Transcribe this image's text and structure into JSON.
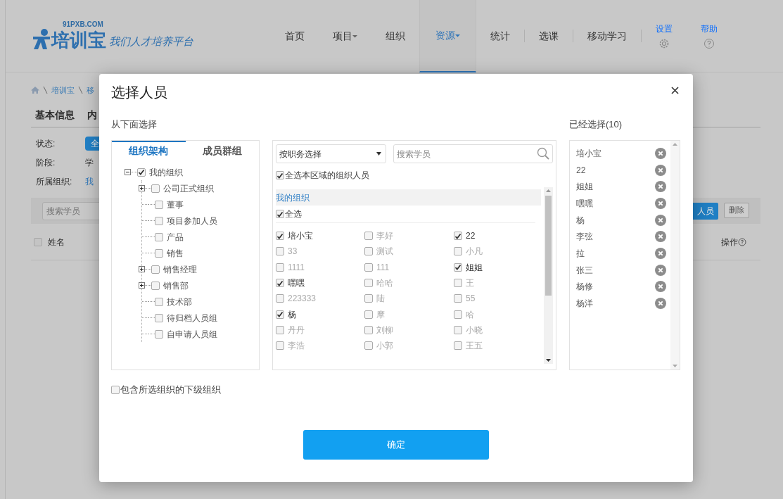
{
  "header": {
    "logo": {
      "domain": "91PXB.COM",
      "name": "培训宝",
      "slogan": "我们人才培养平台"
    },
    "nav": [
      {
        "label": "首页",
        "dropdown": false,
        "selected": false
      },
      {
        "label": "项目",
        "dropdown": true,
        "selected": false
      },
      {
        "label": "组织",
        "dropdown": false,
        "selected": false
      },
      {
        "label": "资源",
        "dropdown": true,
        "selected": true
      },
      {
        "label": "统计",
        "dropdown": false,
        "selected": false
      },
      {
        "label": "选课",
        "dropdown": false,
        "selected": false
      },
      {
        "label": "移动学习",
        "dropdown": false,
        "selected": false
      }
    ],
    "tools": [
      {
        "label": "设置",
        "kind": "settings"
      },
      {
        "label": "帮助",
        "kind": "help"
      }
    ]
  },
  "page": {
    "breadcrumb": [
      "培训宝",
      "移"
    ],
    "tabs": [
      "基本信息",
      "内"
    ],
    "filters": [
      {
        "label": "状态:",
        "value": "全",
        "kind": "pill"
      },
      {
        "label": "阶段:",
        "value": "学",
        "kind": "plain"
      },
      {
        "label": "所属组织:",
        "value": "我",
        "kind": "link"
      }
    ],
    "search": {
      "placeholder": "搜索学员"
    },
    "buttons": [
      {
        "label": "人员",
        "kind": "primary"
      },
      {
        "label": "删除",
        "kind": "outline"
      }
    ],
    "columns": [
      {
        "label": "姓名",
        "kind": "checkbox",
        "checked": false
      },
      {
        "label": "操作",
        "kind": "help"
      }
    ]
  },
  "dialog": {
    "title": "选择人员",
    "source_label": "从下面选择",
    "tabs": [
      {
        "label": "组织架构",
        "selected": true
      },
      {
        "label": "成员群组",
        "selected": false
      }
    ],
    "tree": [
      {
        "label": "我的组织",
        "checked": true,
        "kind": "branch",
        "expanded": true,
        "children": [
          {
            "label": "公司正式组织",
            "checked": false,
            "kind": "branch",
            "expanded": false
          },
          {
            "label": "董事",
            "checked": false,
            "kind": "leaf"
          },
          {
            "label": "项目参加人员",
            "checked": false,
            "kind": "leaf"
          },
          {
            "label": "产品",
            "checked": false,
            "kind": "leaf"
          },
          {
            "label": "销售",
            "checked": false,
            "kind": "leaf"
          },
          {
            "label": "销售经理",
            "checked": false,
            "kind": "branch",
            "expanded": false
          },
          {
            "label": "销售部",
            "checked": false,
            "kind": "branch",
            "expanded": false
          },
          {
            "label": "技术部",
            "checked": false,
            "kind": "leaf"
          },
          {
            "label": "待归档人员组",
            "checked": false,
            "kind": "leaf"
          },
          {
            "label": "自申请人员组",
            "checked": false,
            "kind": "leaf"
          }
        ]
      }
    ],
    "filter_select": {
      "value": "按职务选择"
    },
    "search": {
      "placeholder": "搜索学员"
    },
    "select_area": {
      "label": "全选本区域的组织人员",
      "checked": true
    },
    "group": {
      "title": "我的组织",
      "select_all": {
        "label": "全选",
        "checked": true
      },
      "people": [
        {
          "name": "培小宝",
          "checked": true
        },
        {
          "name": "李好",
          "checked": false
        },
        {
          "name": "22",
          "checked": true
        },
        {
          "name": "33",
          "checked": false
        },
        {
          "name": "测试",
          "checked": false
        },
        {
          "name": "小凡",
          "checked": false
        },
        {
          "name": "1111",
          "checked": false
        },
        {
          "name": "111",
          "checked": false
        },
        {
          "name": "姐姐",
          "checked": true
        },
        {
          "name": "嘿嘿",
          "checked": true
        },
        {
          "name": "哈哈",
          "checked": false
        },
        {
          "name": "王",
          "checked": false
        },
        {
          "name": "223333",
          "checked": false
        },
        {
          "name": "陆",
          "checked": false
        },
        {
          "name": "55",
          "checked": false
        },
        {
          "name": "杨",
          "checked": true
        },
        {
          "name": "摩",
          "checked": false
        },
        {
          "name": "哈",
          "checked": false
        },
        {
          "name": "丹丹",
          "checked": false
        },
        {
          "name": "刘柳",
          "checked": false
        },
        {
          "name": "小晓",
          "checked": false
        },
        {
          "name": "李浩",
          "checked": false
        },
        {
          "name": "小郭",
          "checked": false
        },
        {
          "name": "王五",
          "checked": false
        }
      ]
    },
    "chosen_label": "已经选择(10)",
    "chosen_people": [
      "培小宝",
      "22",
      "姐姐",
      "嘿嘿",
      "杨",
      "李弦",
      "拉",
      "张三",
      "杨修",
      "杨洋"
    ],
    "include_sub": {
      "label": "包含所选组织的下级组织",
      "checked": false
    },
    "confirm": "确定"
  }
}
